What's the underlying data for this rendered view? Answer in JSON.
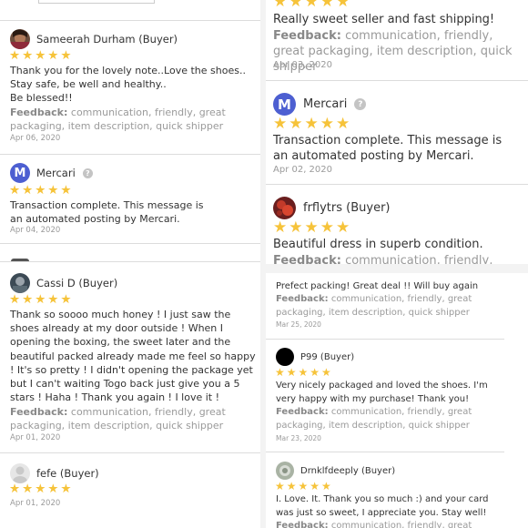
{
  "colors": {
    "star": "#f6c33a",
    "mercari_blue": "#4d5fd1",
    "feedback_text": "#9a9a9a",
    "divider": "#dcdcdc"
  },
  "icons": {
    "star": "star-icon",
    "help": "question-circle-icon",
    "mercari": "mercari-logo-icon"
  },
  "stars": "★★★★★",
  "left": {
    "sameerah": {
      "name": "Sameerah Durham (Buyer)",
      "message": "Thank you for the lovely note..Love the shoes..\nStay safe, be well and healthy..\nBe blessed!!",
      "feedback_label": "Feedback:",
      "feedback": "communication, friendly, great packaging, item description, quick shipper",
      "date": "Apr 06, 2020"
    },
    "mercari": {
      "name": "Mercari",
      "message": "Transaction complete. This message is an automated posting by Mercari.",
      "date": "Apr 04, 2020"
    },
    "cassi": {
      "name": "Cassi D (Buyer)",
      "message": "Thank so soooo much honey ! I just saw the shoes already at my door outside ! When I opening the boxing, the sweet later and the beautiful packed already made me feel so happy ! It's so pretty ! I didn't opening the package yet but I can't waiting Togo back just give you a 5 stars ! Haha ! Thank you again ! I love it !",
      "feedback_label": "Feedback:",
      "feedback": "communication, friendly, great packaging, item description, quick shipper",
      "date": "Apr 01, 2020"
    },
    "fefe": {
      "name": "fefe (Buyer)",
      "date": "Apr 01, 2020"
    }
  },
  "right_top": {
    "first": {
      "message": "Really sweet seller and fast shipping!",
      "feedback_label": "Feedback:",
      "feedback": "communication, friendly, great packaging, item description, quick shipper",
      "date": "Apr 03, 2020"
    },
    "mercari": {
      "name": "Mercari",
      "message": "Transaction complete. This message is an automated posting by Mercari.",
      "date": "Apr 02, 2020"
    },
    "frflytrs": {
      "name": "frflytrs (Buyer)",
      "message": "Beautiful dress in superb condition.",
      "feedback_label": "Feedback:",
      "feedback": "communication, friendly, great"
    }
  },
  "right_bottom": {
    "first": {
      "message": "Prefect packing! Great deal !! Will buy again",
      "feedback_label": "Feedback:",
      "feedback": "communication, friendly, great packaging, item description, quick shipper",
      "date": "Mar 25, 2020"
    },
    "p99": {
      "name": "P99 (Buyer)",
      "message": "Very nicely packaged and loved the shoes. I'm very happy with my purchase! Thank you!",
      "feedback_label": "Feedback:",
      "feedback": "communication, friendly, great packaging, item description, quick shipper",
      "date": "Mar 23, 2020"
    },
    "drnkl": {
      "name": "Drnklfdeeply (Buyer)",
      "message": "I. Love. It. Thank you so much :) and your card was just so sweet, I appreciate you. Stay well!",
      "feedback_label": "Feedback:",
      "feedback": "communication, friendly, great"
    }
  }
}
